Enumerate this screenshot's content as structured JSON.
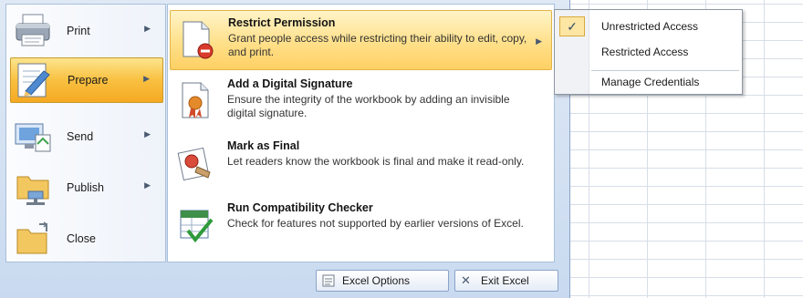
{
  "left_menu": {
    "items": [
      {
        "label": "Print",
        "icon": "printer-icon",
        "has_submenu": true
      },
      {
        "label": "Prepare",
        "icon": "prepare-icon",
        "has_submenu": true,
        "selected": true
      },
      {
        "label": "Send",
        "icon": "send-icon",
        "has_submenu": true
      },
      {
        "label": "Publish",
        "icon": "publish-icon",
        "has_submenu": true
      },
      {
        "label": "Close",
        "icon": "folder-icon",
        "has_submenu": false
      }
    ]
  },
  "prepare_panel": {
    "options": [
      {
        "title": "Restrict Permission",
        "description": "Grant people access while restricting their ability to edit, copy, and print.",
        "icon": "restrict-permission-icon",
        "highlighted": true,
        "has_submenu": true
      },
      {
        "title": "Add a Digital Signature",
        "description": "Ensure the integrity of the workbook by adding an invisible digital signature.",
        "icon": "digital-signature-icon"
      },
      {
        "title": "Mark as Final",
        "description": "Let readers know the workbook is final and make it read-only.",
        "icon": "mark-as-final-icon"
      },
      {
        "title": "Run Compatibility Checker",
        "description": "Check for features not supported by earlier versions of Excel.",
        "icon": "compatibility-checker-icon"
      }
    ]
  },
  "permission_flyout": {
    "items": [
      {
        "label": "Unrestricted Access",
        "checked": true
      },
      {
        "label": "Restricted Access",
        "checked": false
      },
      {
        "label": "Manage Credentials",
        "checked": false
      }
    ],
    "check_glyph": "✓"
  },
  "bottom_buttons": {
    "excel_options": "Excel Options",
    "exit_excel": "Exit Excel",
    "close_glyph": "✕"
  },
  "colors": {
    "menu_background": "#c9daf0",
    "highlight_orange": "#f9c040",
    "highlight_light": "#ffe08a",
    "border_blue": "#8aa4c8"
  }
}
